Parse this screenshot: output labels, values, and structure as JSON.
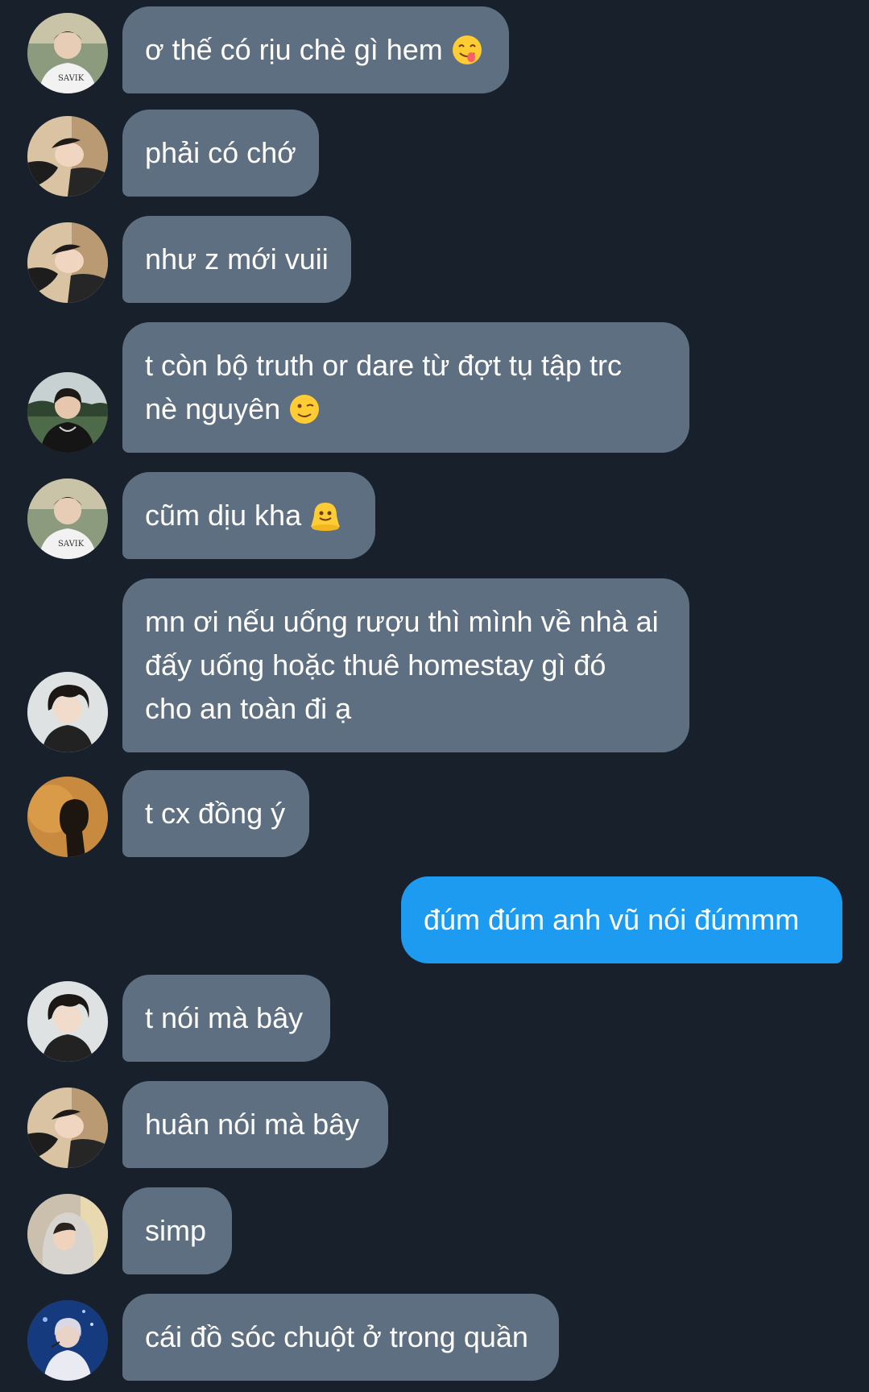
{
  "colors": {
    "background": "#18202b",
    "incoming_bubble": "#5f6f82",
    "outgoing_bubble": "#1c9bf0",
    "text": "#ffffff"
  },
  "messages": [
    {
      "direction": "incoming",
      "avatar": "avatar-boy-white-shirt",
      "lines": [
        "ơ thế có rịu chè gì hem"
      ],
      "emoji": "face-savoring-food"
    },
    {
      "direction": "incoming",
      "avatar": "avatar-boy-lying",
      "lines": [
        "phải có chớ"
      ],
      "emoji": ""
    },
    {
      "direction": "incoming",
      "avatar": "avatar-boy-lying",
      "lines": [
        "như z mới vuii"
      ],
      "emoji": ""
    },
    {
      "direction": "incoming",
      "avatar": "avatar-boy-outdoor",
      "lines": [
        "t còn bộ truth or dare từ đợt tụ tập trc",
        "nè nguyên"
      ],
      "emoji": "winking-face"
    },
    {
      "direction": "incoming",
      "avatar": "avatar-boy-white-shirt",
      "lines": [
        "cũm dịu kha"
      ],
      "emoji": "melting-face"
    },
    {
      "direction": "incoming",
      "avatar": "avatar-boy-curly-hair",
      "lines": [
        "mn ơi nếu uống rượu thì mình về nhà ai",
        "đấy uống hoặc thuê homestay gì đó",
        "cho an toàn đi ạ"
      ],
      "emoji": ""
    },
    {
      "direction": "incoming",
      "avatar": "avatar-silhouette-orange",
      "lines": [
        "t cx đồng ý"
      ],
      "emoji": ""
    },
    {
      "direction": "outgoing",
      "avatar": "",
      "lines": [
        "đúm đúm anh vũ nói đúmmm"
      ],
      "emoji": ""
    },
    {
      "direction": "incoming",
      "avatar": "avatar-boy-curly-hair",
      "lines": [
        "t nói mà bây"
      ],
      "emoji": ""
    },
    {
      "direction": "incoming",
      "avatar": "avatar-boy-lying",
      "lines": [
        "huân nói mà bây"
      ],
      "emoji": ""
    },
    {
      "direction": "incoming",
      "avatar": "avatar-boy-hood",
      "lines": [
        "simp"
      ],
      "emoji": ""
    },
    {
      "direction": "incoming",
      "avatar": "avatar-boy-stage-blue",
      "lines": [
        "cái đồ sóc chuột ở trong quần"
      ],
      "emoji": ""
    }
  ]
}
